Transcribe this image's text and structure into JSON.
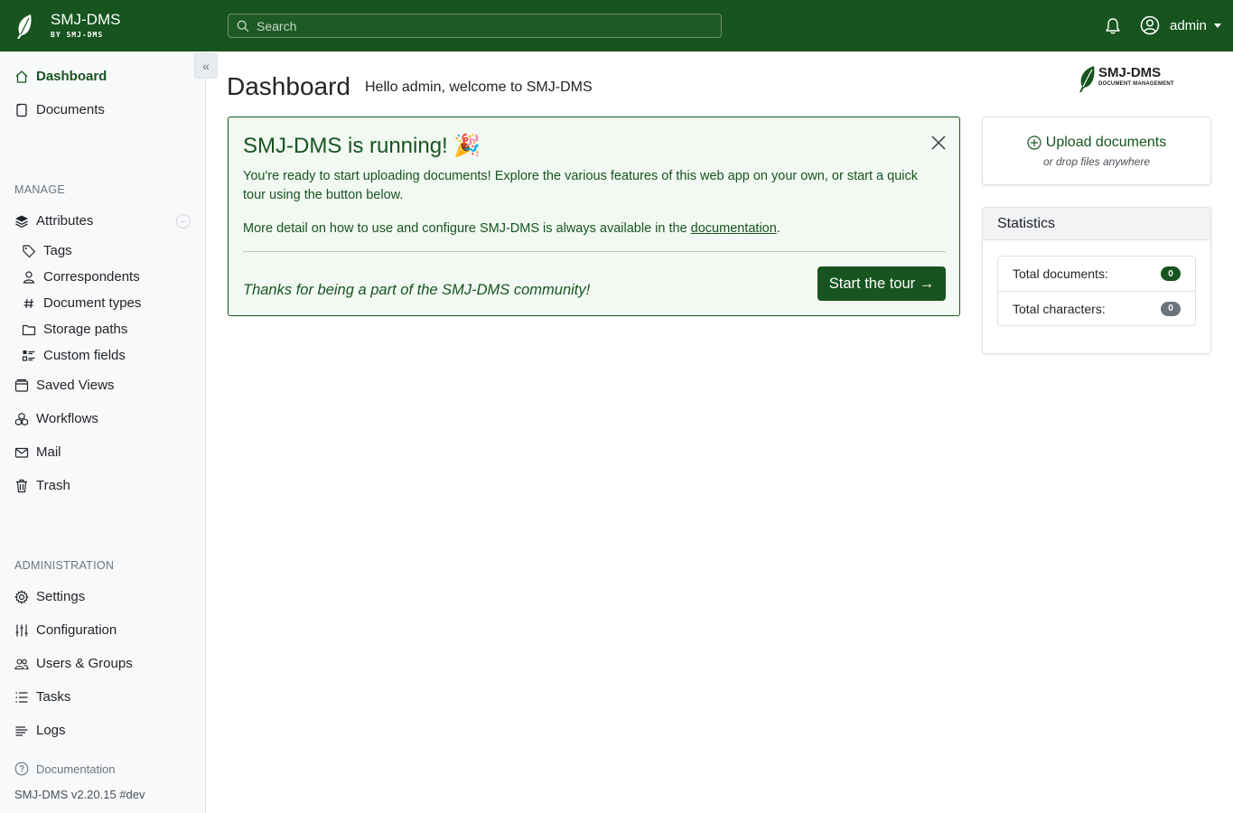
{
  "app": {
    "name": "SMJ-DMS",
    "byline": "BY SMJ-DMS",
    "logo_name": "SMJ-DMS",
    "logo_sub": "DOCUMENT MANAGEMENT",
    "brand_color": "#17541f"
  },
  "search": {
    "placeholder": "Search"
  },
  "user": {
    "name": "admin"
  },
  "sidebar": {
    "collapse_icon": "«",
    "main": [
      {
        "label": "Dashboard",
        "icon": "house-icon",
        "active": true
      },
      {
        "label": "Documents",
        "icon": "file-icon"
      }
    ],
    "manage_title": "MANAGE",
    "attributes_label": "Attributes",
    "attributes_sub": [
      {
        "label": "Tags",
        "icon": "tag-icon"
      },
      {
        "label": "Correspondents",
        "icon": "person-icon"
      },
      {
        "label": "Document types",
        "icon": "hash-icon"
      },
      {
        "label": "Storage paths",
        "icon": "folder-icon"
      },
      {
        "label": "Custom fields",
        "icon": "list-icon"
      }
    ],
    "manage_items": [
      {
        "label": "Saved Views",
        "icon": "window-icon"
      },
      {
        "label": "Workflows",
        "icon": "boxes-icon"
      },
      {
        "label": "Mail",
        "icon": "envelope-icon"
      },
      {
        "label": "Trash",
        "icon": "trash-icon"
      }
    ],
    "admin_title": "ADMINISTRATION",
    "admin_items": [
      {
        "label": "Settings",
        "icon": "gear-icon"
      },
      {
        "label": "Configuration",
        "icon": "sliders-icon"
      },
      {
        "label": "Users & Groups",
        "icon": "people-icon"
      },
      {
        "label": "Tasks",
        "icon": "tasks-icon"
      },
      {
        "label": "Logs",
        "icon": "text-lines-icon"
      }
    ],
    "documentation": "Documentation",
    "version": "SMJ-DMS v2.20.15 #dev"
  },
  "main": {
    "title": "Dashboard",
    "welcome": "Hello admin, welcome to SMJ-DMS",
    "alert": {
      "title": "SMJ-DMS is running! 🎉",
      "p1": "You're ready to start uploading documents! Explore the various features of this web app on your own, or start a quick tour using the button below.",
      "p2_prefix": "More detail on how to use and configure SMJ-DMS is always available in the ",
      "p2_link": "documentation",
      "p2_suffix": ".",
      "thanks": "Thanks for being a part of the SMJ-DMS community!",
      "tour_button": "Start the tour →"
    },
    "upload": {
      "title": "Upload documents",
      "subtitle": "or drop files anywhere"
    },
    "statistics": {
      "title": "Statistics",
      "rows": [
        {
          "label": "Total documents:",
          "value": "0"
        },
        {
          "label": "Total characters:",
          "value": "0"
        }
      ]
    }
  }
}
